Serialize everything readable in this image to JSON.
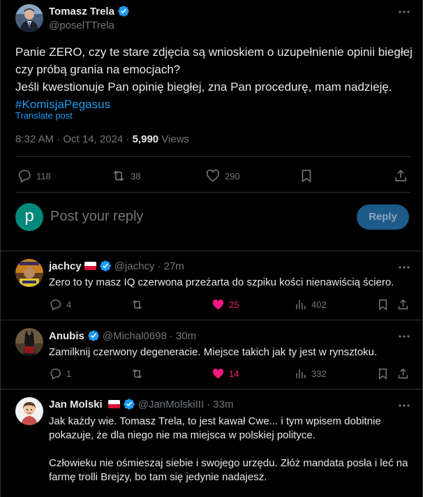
{
  "main_tweet": {
    "author_name": "Tomasz Trela",
    "author_handle": "@poselTTrela",
    "text_line1": "Panie ZERO, czy te stare zdjęcia są wnioskiem o uzupełnienie opinii biegłej czy próbą grania na emocjach?",
    "text_line2": "Jeśli kwestionuje Pan opinię biegłej, zna Pan procedurę, mam nadzieję.",
    "hashtag": "#KomisjaPegasus",
    "translate": "Translate post",
    "timestamp": "8:32 AM · Oct 14, 2024 · ",
    "views_count": "5,990",
    "views_label": " Views",
    "replies": "118",
    "reposts": "38",
    "likes": "290"
  },
  "reply_box": {
    "avatar_letter": "p",
    "placeholder": "Post your reply",
    "button": "Reply"
  },
  "replies": [
    {
      "name": "jachcy",
      "handle": "@jachcy",
      "time": "· 27m",
      "text": "Zero to ty masz IQ czerwona przeżarta do szpiku kości nienawiścią ściero.",
      "replies": "4",
      "reposts": "",
      "likes": "25",
      "views": "402",
      "flag": true
    },
    {
      "name": "Anubis",
      "handle": "@Michal0698",
      "time": "· 30m",
      "text": "Zamilknij czerwony degeneracie. Miejsce takich jak ty jest w rynsztoku.",
      "replies": "1",
      "reposts": "",
      "likes": "14",
      "views": "332",
      "flag": false
    },
    {
      "name": "Jan Molski",
      "handle": "@JanMolskiIII",
      "time": "· 33m",
      "text_p1": "Jak każdy wie. Tomasz Trela, to jest kawał Cwe... i tym wpisem dobitnie pokazuje, że dla niego nie ma miejsca w polskiej polityce.",
      "text_p2": "Człowieku nie ośmieszaj siebie i swojego urzędu. Złóż mandata posła i leć na farmę trolli Brejzy, bo tam się jedynie nadajesz.",
      "flag": true
    }
  ],
  "colors": {
    "background": "#000000",
    "accent": "#1d9bf0",
    "like": "#f91880",
    "muted": "#71767b",
    "border": "#2f3336"
  },
  "icons": [
    "verified-badge-icon",
    "more-icon",
    "reply-icon",
    "repost-icon",
    "like-icon",
    "bookmark-icon",
    "share-icon",
    "views-icon"
  ]
}
